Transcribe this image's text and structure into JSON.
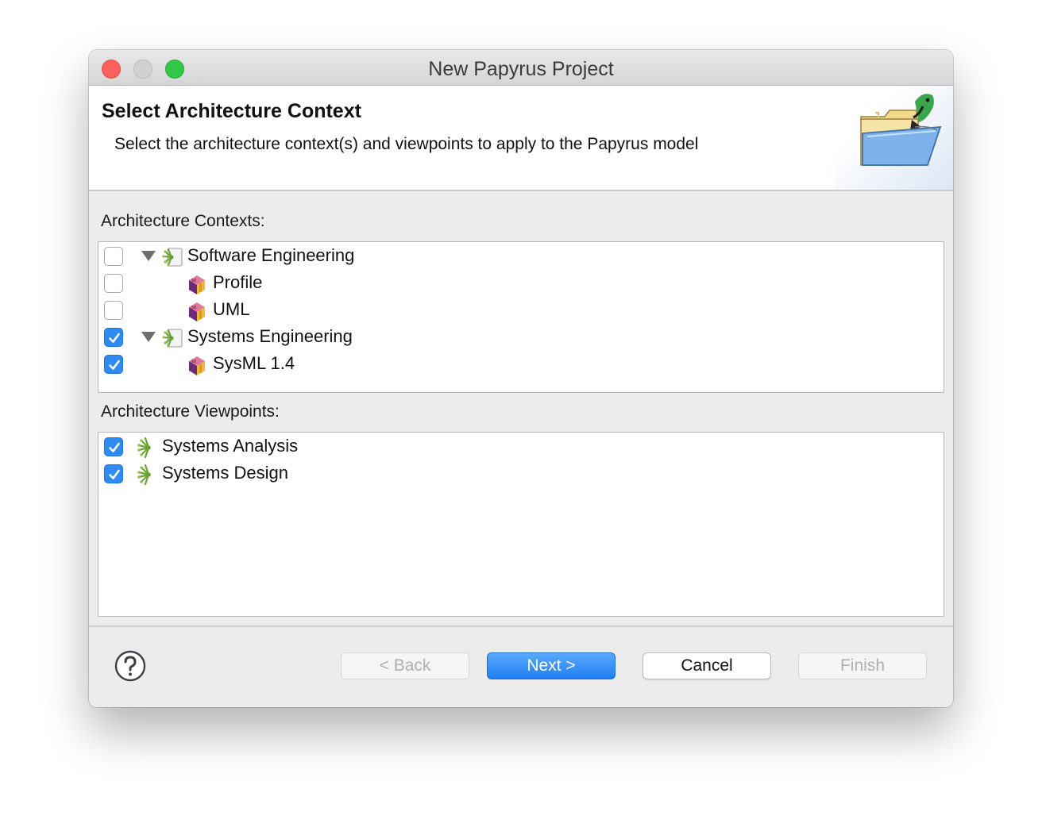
{
  "window": {
    "title": "New Papyrus Project"
  },
  "banner": {
    "title": "Select Architecture Context",
    "description": "Select the architecture context(s) and viewpoints to apply to the Papyrus model",
    "icon": "papyrus-folder-icon"
  },
  "contexts": {
    "label": "Architecture Contexts:",
    "items": [
      {
        "label": "Software Engineering",
        "checked": false,
        "expanded": true,
        "icon": "architecture-context-icon",
        "level": 0
      },
      {
        "label": "Profile",
        "checked": false,
        "icon": "model-kind-icon",
        "level": 1
      },
      {
        "label": "UML",
        "checked": false,
        "icon": "model-kind-icon",
        "level": 1
      },
      {
        "label": "Systems Engineering",
        "checked": true,
        "expanded": true,
        "icon": "architecture-context-icon",
        "level": 0
      },
      {
        "label": "SysML 1.4",
        "checked": true,
        "icon": "model-kind-icon",
        "level": 1
      }
    ]
  },
  "viewpoints": {
    "label": "Architecture Viewpoints:",
    "items": [
      {
        "label": "Systems Analysis",
        "checked": true,
        "icon": "viewpoint-icon"
      },
      {
        "label": "Systems Design",
        "checked": true,
        "icon": "viewpoint-icon"
      }
    ]
  },
  "buttons": {
    "back": "< Back",
    "next": "Next >",
    "cancel": "Cancel",
    "finish": "Finish"
  },
  "colors": {
    "accent": "#2d8bf2",
    "default_button": "#1f7ff3"
  }
}
